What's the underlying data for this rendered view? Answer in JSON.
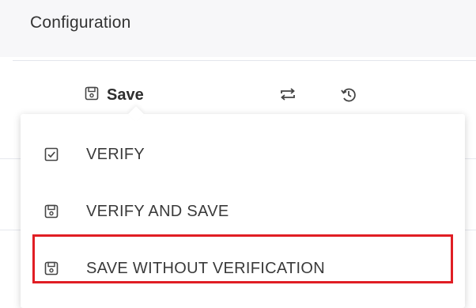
{
  "header": {
    "title": "Configuration"
  },
  "toolbar": {
    "save_label": "Save",
    "icons": [
      "floppy-icon",
      "repeat-icon",
      "history-icon"
    ]
  },
  "menu": {
    "items": [
      {
        "label": "VERIFY",
        "icon": "checkbox-icon"
      },
      {
        "label": "VERIFY AND SAVE",
        "icon": "floppy-icon"
      },
      {
        "label": "SAVE WITHOUT VERIFICATION",
        "icon": "floppy-icon",
        "highlighted": true
      }
    ]
  },
  "colors": {
    "highlight_border": "#e01e24",
    "text": "#3a3a3a",
    "header_bg": "#f7f7f9"
  }
}
